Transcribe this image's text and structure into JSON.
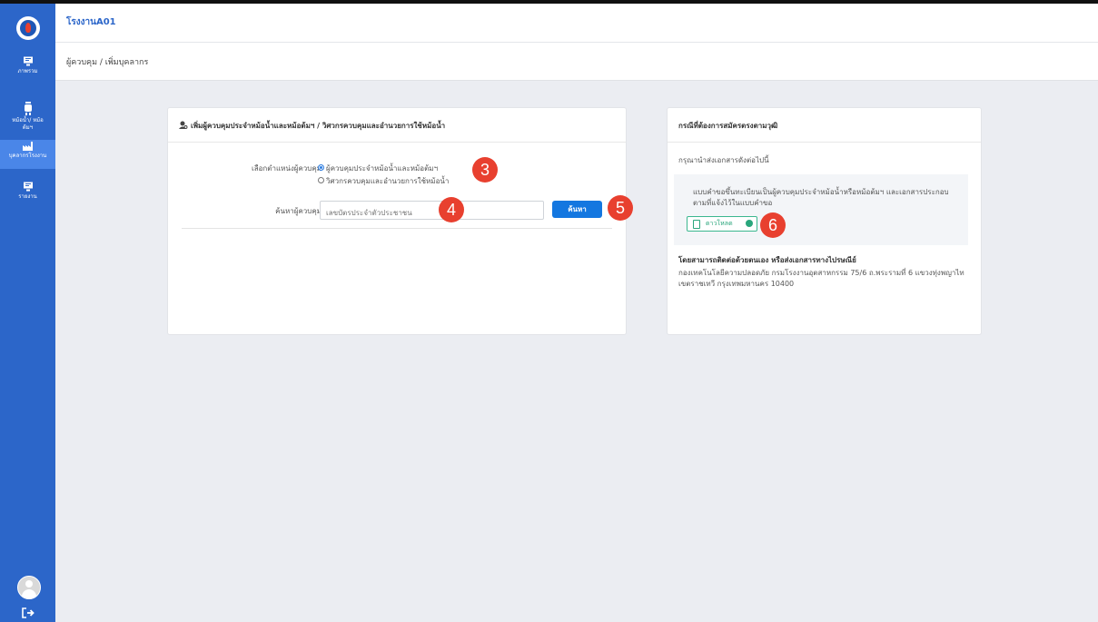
{
  "app": {
    "title": "โรงงานA01",
    "breadcrumb": "ผู้ควบคุม / เพิ่มบุคลากร"
  },
  "sidebar": {
    "items": [
      {
        "label": "ภาพรวม",
        "icon": "monitor-icon"
      },
      {
        "label": "หม้อน้ำ/ หม้อต้มฯ",
        "icon": "boiler-icon"
      },
      {
        "label": "บุคลากรโรงงาน",
        "icon": "factory-icon",
        "active": true
      },
      {
        "label": "รายงาน",
        "icon": "report-icon"
      }
    ]
  },
  "form_card": {
    "title": "เพิ่มผู้ควบคุมประจำหม้อน้ำและหม้อต้มฯ / วิศวกรควบคุมและอำนวยการใช้หม้อน้ำ",
    "position_label": "เลือกตำแหน่งผู้ควบคุม",
    "options": [
      {
        "label": "ผู้ควบคุมประจำหม้อน้ำและหม้อต้มฯ",
        "selected": true
      },
      {
        "label": "วิศวกรควบคุมและอำนวยการใช้หม้อน้ำ",
        "selected": false
      }
    ],
    "search_label": "ค้นหาผู้ควบคุม",
    "search_placeholder": "เลขบัตรประจำตัวประชาชน",
    "search_button": "ค้นหา"
  },
  "info_card": {
    "title": "กรณีที่ต้องการสมัครตรงตามวุฒิ",
    "intro": "กรุณานำส่งเอกสารดังต่อไปนี้",
    "doc_text": "แบบคำขอขึ้นทะเบียนเป็นผู้ควบคุมประจำหม้อน้ำหรือหม้อต้มฯ และเอกสารประกอบตามที่แจ้งไว้ในแบบคำขอ",
    "download_label": "ดาวโหลด",
    "contact_title": "โดยสามารถติดต่อด้วยตนเอง หรือส่งเอกสารทางไปรษณีย์",
    "address": "กองเทคโนโลยีความปลอดภัย กรมโรงงานอุตสาหกรรม 75/6 ถ.พระรามที่ 6 แขวงทุ่งพญาไท เขตราชเทวี กรุงเทพมหานคร 10400"
  },
  "annotations": [
    "3",
    "4",
    "5",
    "6"
  ],
  "colors": {
    "sidebar": "#2c66c9",
    "primary_button": "#1477e0",
    "annotation_badge": "#e8402f",
    "download_green": "#2aa67c"
  }
}
